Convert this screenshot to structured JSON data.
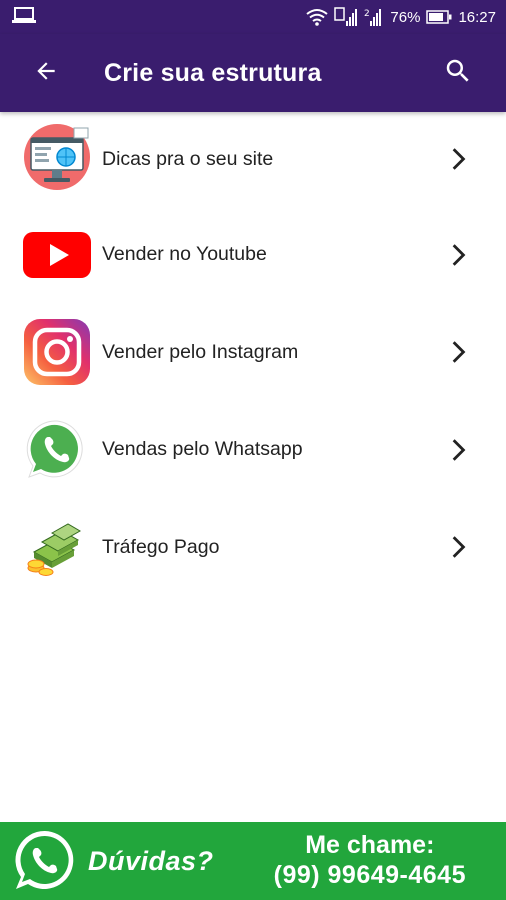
{
  "status_bar": {
    "battery": "76%",
    "time": "16:27",
    "icons": [
      "laptop-icon",
      "wifi-icon",
      "sim1-signal-icon",
      "sim2-signal-icon",
      "battery-icon"
    ]
  },
  "app_bar": {
    "title": "Crie sua estrutura",
    "back_icon": "arrow-back-icon",
    "search_icon": "search-icon"
  },
  "menu": {
    "items": [
      {
        "label": "Dicas pra o seu site",
        "icon": "website-monitor-icon"
      },
      {
        "label": "Vender no Youtube",
        "icon": "youtube-icon"
      },
      {
        "label": "Vender pelo Instagram",
        "icon": "instagram-icon"
      },
      {
        "label": "Vendas pelo Whatsapp",
        "icon": "whatsapp-icon"
      },
      {
        "label": "Tráfego Pago",
        "icon": "money-stack-icon"
      }
    ]
  },
  "footer": {
    "question": "Dúvidas?",
    "call_me": "Me chame:",
    "phone": "(99) 99649-4645",
    "icon": "whatsapp-icon"
  },
  "colors": {
    "primary": "#3a1d6e",
    "footer_green": "#22a63c",
    "youtube_red": "#ff0000",
    "whatsapp_green": "#4caf50"
  }
}
